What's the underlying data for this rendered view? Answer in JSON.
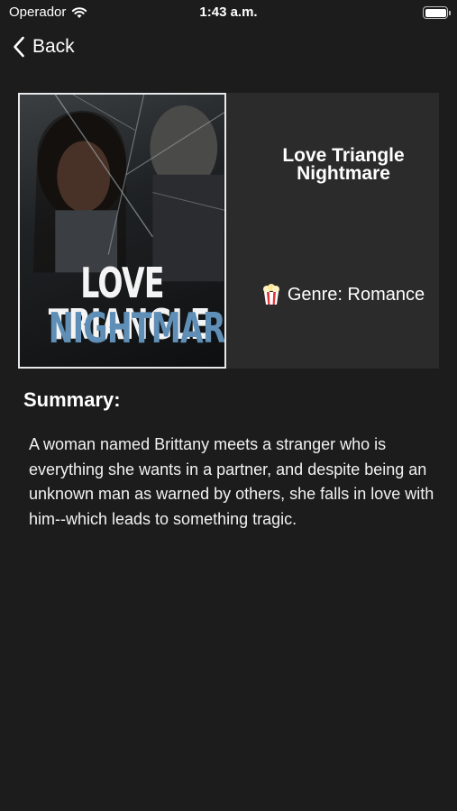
{
  "status_bar": {
    "carrier": "Operador",
    "time": "1:43 a.m.",
    "wifi_icon": "wifi-icon",
    "battery_icon": "battery-icon"
  },
  "nav": {
    "back_label": "Back",
    "back_icon": "chevron-left-icon"
  },
  "movie": {
    "title": "Love Triangle Nightmare",
    "poster": {
      "line1": "LOVE TRIANGLE",
      "line2": "NIGHTMARE",
      "colors": {
        "line1": "#f4f4f4",
        "line2": "#5f8fb6",
        "border": "#e8e8e8"
      }
    },
    "genre_icon": "popcorn-icon",
    "genre_text": "Genre: Romance"
  },
  "summary": {
    "heading": "Summary:",
    "text": "A woman named Brittany meets a stranger who is everything she wants in a partner, and despite being an unknown man as warned by others, she falls in love with him--which leads to something tragic."
  },
  "theme": {
    "background": "#1c1c1c",
    "card_background": "#2b2b2b",
    "text": "#ffffff"
  }
}
